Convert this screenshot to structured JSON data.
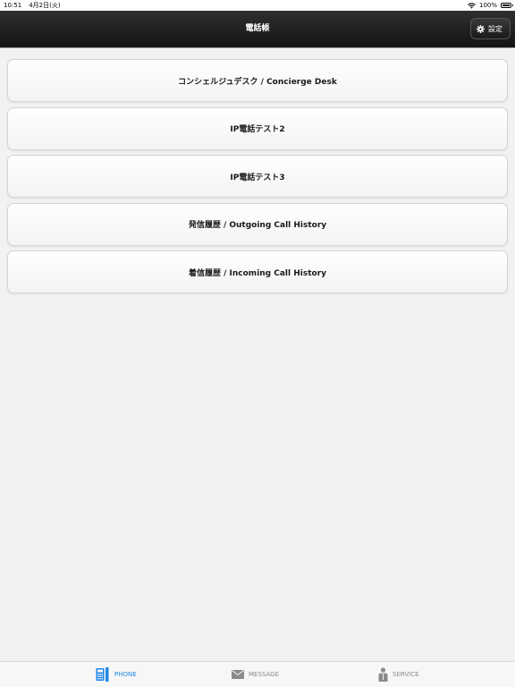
{
  "status_bar": {
    "time": "10:51",
    "date": "4月2日(火)",
    "battery": "100%"
  },
  "nav": {
    "title": "電話帳",
    "settings_label": "設定"
  },
  "list": {
    "items": [
      {
        "label": "コンシェルジュデスク / Concierge Desk"
      },
      {
        "label": "IP電話テスト2"
      },
      {
        "label": "IP電話テスト3"
      },
      {
        "label": "発信履歴 / Outgoing Call History"
      },
      {
        "label": "着信履歴 / Incoming Call History"
      }
    ]
  },
  "tabs": [
    {
      "label": "PHONE",
      "icon": "phone-icon",
      "active": true
    },
    {
      "label": "MESSAGE",
      "icon": "envelope-icon",
      "active": false
    },
    {
      "label": "SERVICE",
      "icon": "concierge-icon",
      "active": false
    }
  ],
  "colors": {
    "nav_bg": "#1f1f1f",
    "accent": "#1e87e5",
    "inactive_tab": "#8a8a8a",
    "background": "#f2f2f2"
  }
}
